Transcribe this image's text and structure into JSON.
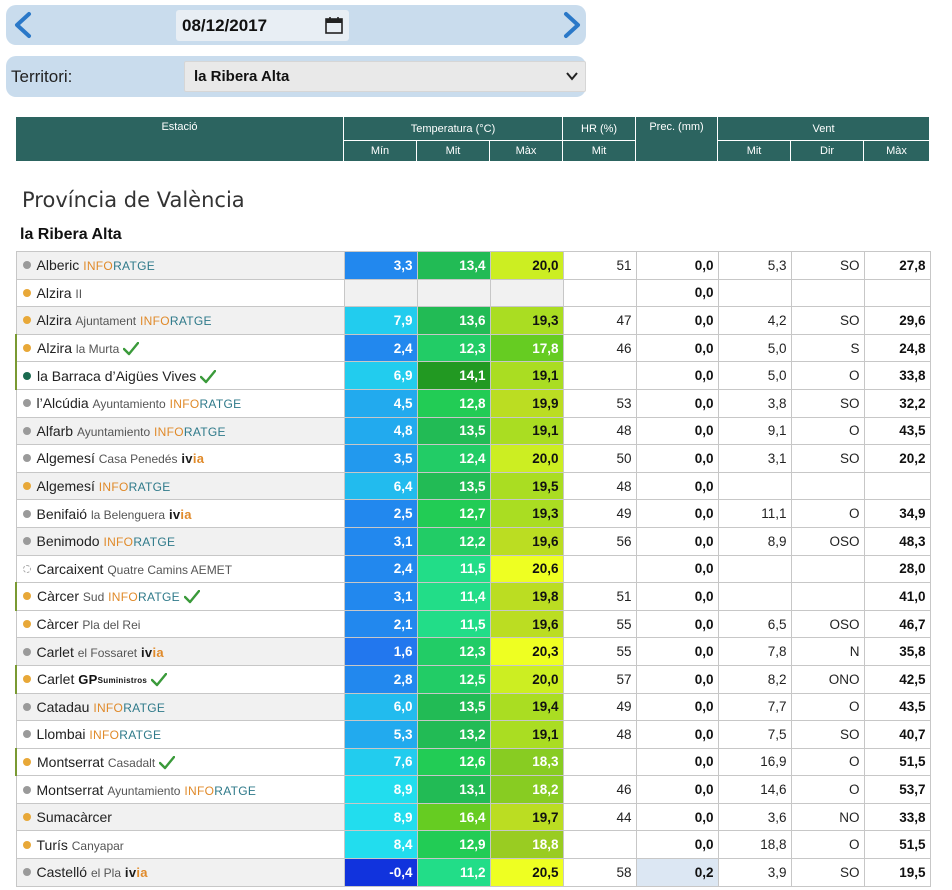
{
  "date": "08/12/2017",
  "territori_label": "Territori:",
  "territori_value": "la Ribera Alta",
  "headers": {
    "estacio": "Estació",
    "temp": "Temperatura (°C)",
    "hr": "HR (%)",
    "prec": "Prec. (mm)",
    "vent": "Vent",
    "min": "Mín",
    "mit": "Mit",
    "max": "Màx",
    "hr_mit": "Mit",
    "vent_mit": "Mit",
    "vent_dir": "Dir",
    "vent_max": "Màx"
  },
  "province": "Província de València",
  "region": "la Ribera Alta",
  "rows": [
    {
      "name": "Alberic",
      "sub": "",
      "src": "INFORATGE",
      "dot": "grey",
      "check": false,
      "hl": false,
      "tmin": "3,3",
      "tmit": "13,4",
      "tmax": "20,0",
      "hr": "51",
      "prec": "0,0",
      "vmit": "5,3",
      "dir": "SO",
      "vmax": "27,8",
      "cmin": "#2288ee",
      "cmit": "#22bb55",
      "cmax": "#ccee22"
    },
    {
      "name": "Alzira",
      "sub": "II",
      "src": "",
      "dot": "orange",
      "check": false,
      "hl": false,
      "tmin": "",
      "tmit": "",
      "tmax": "",
      "hr": "",
      "prec": "0,0",
      "vmit": "",
      "dir": "",
      "vmax": "",
      "cmin": "",
      "cmit": "",
      "cmax": ""
    },
    {
      "name": "Alzira",
      "sub": "Ajuntament",
      "src": "INFORATGE",
      "dot": "orange",
      "check": false,
      "hl": false,
      "tmin": "7,9",
      "tmit": "13,6",
      "tmax": "19,3",
      "hr": "47",
      "prec": "0,0",
      "vmit": "4,2",
      "dir": "SO",
      "vmax": "29,6",
      "cmin": "#22ccee",
      "cmit": "#22bb55",
      "cmax": "#aadd22"
    },
    {
      "name": "Alzira",
      "sub": "la Murta",
      "src": "",
      "dot": "orange",
      "check": true,
      "hl": true,
      "tmin": "2,4",
      "tmit": "12,3",
      "tmax": "17,8",
      "hr": "46",
      "prec": "0,0",
      "vmit": "5,0",
      "dir": "S",
      "vmax": "24,8",
      "cmin": "#2288ee",
      "cmit": "#22cc66",
      "cmax": "#66cc22"
    },
    {
      "name": "la Barraca d’Aigües Vives",
      "sub": "",
      "src": "",
      "dot": "green",
      "check": true,
      "hl": true,
      "tmin": "6,9",
      "tmit": "14,1",
      "tmax": "19,1",
      "hr": "",
      "prec": "0,0",
      "vmit": "5,0",
      "dir": "O",
      "vmax": "33,8",
      "cmin": "#22ccee",
      "cmit": "#229922",
      "cmax": "#aadd22"
    },
    {
      "name": "l’Alcúdia",
      "sub": "Ayuntamiento",
      "src": "INFORATGE",
      "dot": "grey",
      "check": false,
      "hl": false,
      "tmin": "4,5",
      "tmit": "12,8",
      "tmax": "19,9",
      "hr": "53",
      "prec": "0,0",
      "vmit": "3,8",
      "dir": "SO",
      "vmax": "32,2",
      "cmin": "#22aaee",
      "cmit": "#22cc55",
      "cmax": "#bbdd22"
    },
    {
      "name": "Alfarb",
      "sub": "Ayuntamiento",
      "src": "INFORATGE",
      "dot": "grey",
      "check": false,
      "hl": false,
      "tmin": "4,8",
      "tmit": "13,5",
      "tmax": "19,1",
      "hr": "48",
      "prec": "0,0",
      "vmit": "9,1",
      "dir": "O",
      "vmax": "43,5",
      "cmin": "#22aaee",
      "cmit": "#22bb55",
      "cmax": "#aadd22"
    },
    {
      "name": "Algemesí",
      "sub": "Casa Penedés",
      "src": "ivia",
      "dot": "grey",
      "check": false,
      "hl": false,
      "tmin": "3,5",
      "tmit": "12,4",
      "tmax": "20,0",
      "hr": "50",
      "prec": "0,0",
      "vmit": "3,1",
      "dir": "SO",
      "vmax": "20,2",
      "cmin": "#2299ee",
      "cmit": "#22cc66",
      "cmax": "#ccee22"
    },
    {
      "name": "Algemesí",
      "sub": "",
      "src": "INFORATGE",
      "dot": "orange",
      "check": false,
      "hl": false,
      "tmin": "6,4",
      "tmit": "13,5",
      "tmax": "19,5",
      "hr": "48",
      "prec": "0,0",
      "vmit": "",
      "dir": "",
      "vmax": "",
      "cmin": "#22bbee",
      "cmit": "#22bb55",
      "cmax": "#aadd22"
    },
    {
      "name": "Benifaió",
      "sub": "la Belenguera",
      "src": "ivia",
      "dot": "grey",
      "check": false,
      "hl": false,
      "tmin": "2,5",
      "tmit": "12,7",
      "tmax": "19,3",
      "hr": "49",
      "prec": "0,0",
      "vmit": "11,1",
      "dir": "O",
      "vmax": "34,9",
      "cmin": "#2288ee",
      "cmit": "#22cc55",
      "cmax": "#aadd22"
    },
    {
      "name": "Benimodo",
      "sub": "",
      "src": "INFORATGE",
      "dot": "grey",
      "check": false,
      "hl": false,
      "tmin": "3,1",
      "tmit": "12,2",
      "tmax": "19,6",
      "hr": "56",
      "prec": "0,0",
      "vmit": "8,9",
      "dir": "OSO",
      "vmax": "48,3",
      "cmin": "#2288ee",
      "cmit": "#22cc66",
      "cmax": "#bbdd22"
    },
    {
      "name": "Carcaixent",
      "sub": "Quatre Camins AEMET",
      "src": "",
      "dot": "dashed",
      "check": false,
      "hl": false,
      "tmin": "2,4",
      "tmit": "11,5",
      "tmax": "20,6",
      "hr": "",
      "prec": "0,0",
      "vmit": "",
      "dir": "",
      "vmax": "28,0",
      "cmin": "#2288ee",
      "cmit": "#22dd88",
      "cmax": "#eeff22"
    },
    {
      "name": "Càrcer",
      "sub": "Sud",
      "src": "INFORATGE",
      "dot": "orange",
      "check": true,
      "hl": true,
      "tmin": "3,1",
      "tmit": "11,4",
      "tmax": "19,8",
      "hr": "51",
      "prec": "0,0",
      "vmit": "",
      "dir": "",
      "vmax": "41,0",
      "cmin": "#2288ee",
      "cmit": "#22dd88",
      "cmax": "#bbdd22"
    },
    {
      "name": "Càrcer",
      "sub": "Pla del Rei",
      "src": "",
      "dot": "orange",
      "check": false,
      "hl": false,
      "tmin": "2,1",
      "tmit": "11,5",
      "tmax": "19,6",
      "hr": "55",
      "prec": "0,0",
      "vmit": "6,5",
      "dir": "OSO",
      "vmax": "46,7",
      "cmin": "#2288ee",
      "cmit": "#22dd88",
      "cmax": "#bbdd22"
    },
    {
      "name": "Carlet",
      "sub": "el Fossaret",
      "src": "ivia",
      "dot": "grey",
      "check": false,
      "hl": false,
      "tmin": "1,6",
      "tmit": "12,3",
      "tmax": "20,3",
      "hr": "55",
      "prec": "0,0",
      "vmit": "7,8",
      "dir": "N",
      "vmax": "35,8",
      "cmin": "#2277ee",
      "cmit": "#22cc66",
      "cmax": "#eeff22"
    },
    {
      "name": "Carlet",
      "sub": "",
      "src": "GP",
      "dot": "orange",
      "check": true,
      "hl": true,
      "tmin": "2,8",
      "tmit": "12,5",
      "tmax": "20,0",
      "hr": "57",
      "prec": "0,0",
      "vmit": "8,2",
      "dir": "ONO",
      "vmax": "42,5",
      "cmin": "#2288ee",
      "cmit": "#22cc66",
      "cmax": "#ccee22"
    },
    {
      "name": "Catadau",
      "sub": "",
      "src": "INFORATGE",
      "dot": "grey",
      "check": false,
      "hl": false,
      "tmin": "6,0",
      "tmit": "13,5",
      "tmax": "19,4",
      "hr": "49",
      "prec": "0,0",
      "vmit": "7,7",
      "dir": "O",
      "vmax": "43,5",
      "cmin": "#22bbee",
      "cmit": "#22bb55",
      "cmax": "#aadd22"
    },
    {
      "name": "Llombai",
      "sub": "",
      "src": "INFORATGE",
      "dot": "grey",
      "check": false,
      "hl": false,
      "tmin": "5,3",
      "tmit": "13,2",
      "tmax": "19,1",
      "hr": "48",
      "prec": "0,0",
      "vmit": "7,5",
      "dir": "SO",
      "vmax": "40,7",
      "cmin": "#22aaee",
      "cmit": "#22bb55",
      "cmax": "#aadd22"
    },
    {
      "name": "Montserrat",
      "sub": "Casadalt",
      "src": "",
      "dot": "orange",
      "check": true,
      "hl": true,
      "tmin": "7,6",
      "tmit": "12,6",
      "tmax": "18,3",
      "hr": "",
      "prec": "0,0",
      "vmit": "16,9",
      "dir": "O",
      "vmax": "51,5",
      "cmin": "#22ccee",
      "cmit": "#22cc55",
      "cmax": "#88cc22"
    },
    {
      "name": "Montserrat",
      "sub": "Ayuntamiento",
      "src": "INFORATGE",
      "dot": "grey",
      "check": false,
      "hl": false,
      "tmin": "8,9",
      "tmit": "13,1",
      "tmax": "18,2",
      "hr": "46",
      "prec": "0,0",
      "vmit": "14,6",
      "dir": "O",
      "vmax": "53,7",
      "cmin": "#22ddee",
      "cmit": "#22bb55",
      "cmax": "#88cc22"
    },
    {
      "name": "Sumacàrcer",
      "sub": "",
      "src": "",
      "dot": "orange",
      "check": false,
      "hl": false,
      "tmin": "8,9",
      "tmit": "16,4",
      "tmax": "19,7",
      "hr": "44",
      "prec": "0,0",
      "vmit": "3,6",
      "dir": "NO",
      "vmax": "33,8",
      "cmin": "#22ddee",
      "cmit": "#66cc22",
      "cmax": "#bbdd22"
    },
    {
      "name": "Turís",
      "sub": "Canyapar",
      "src": "",
      "dot": "orange",
      "check": false,
      "hl": false,
      "tmin": "8,4",
      "tmit": "12,9",
      "tmax": "18,8",
      "hr": "",
      "prec": "0,0",
      "vmit": "18,8",
      "dir": "O",
      "vmax": "51,5",
      "cmin": "#22ddee",
      "cmit": "#22cc55",
      "cmax": "#99cc22"
    },
    {
      "name": "Castelló",
      "sub": "el Pla",
      "src": "ivia",
      "dot": "grey",
      "check": false,
      "hl": false,
      "tmin": "-0,4",
      "tmit": "11,2",
      "tmax": "20,5",
      "hr": "58",
      "prec": "0,2",
      "vmit": "3,9",
      "dir": "SO",
      "vmax": "19,5",
      "cmin": "#1133dd",
      "cmit": "#22dd88",
      "cmax": "#eeff22"
    }
  ]
}
